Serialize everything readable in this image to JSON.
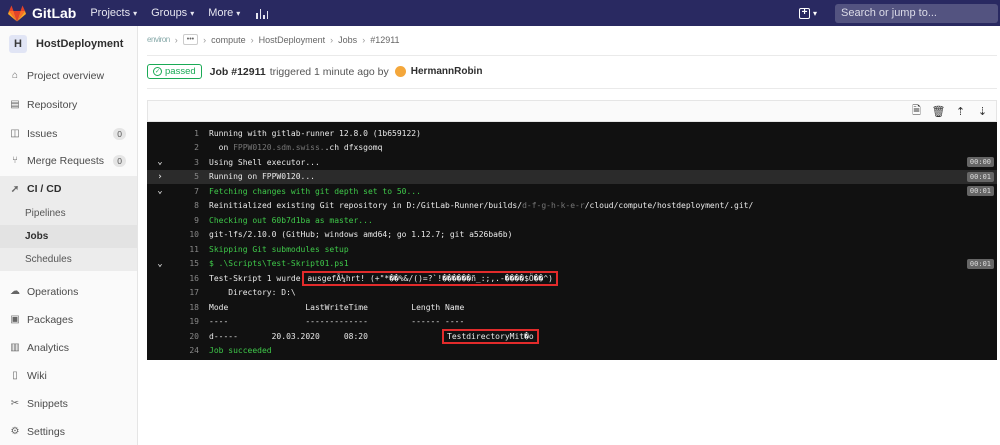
{
  "navbar": {
    "brand": "GitLab",
    "menu": [
      "Projects",
      "Groups",
      "More"
    ],
    "search_placeholder": "Search or jump to..."
  },
  "sidebar": {
    "project_initial": "H",
    "project_name": "HostDeployment",
    "items": [
      {
        "label": "Project overview",
        "icon": "home-icon"
      },
      {
        "label": "Repository",
        "icon": "doc-icon"
      },
      {
        "label": "Issues",
        "icon": "issues-icon",
        "badge": "0"
      },
      {
        "label": "Merge Requests",
        "icon": "merge-icon",
        "badge": "0"
      },
      {
        "label": "CI / CD",
        "icon": "rocket-icon"
      },
      {
        "label": "Operations",
        "icon": "cloud-icon"
      },
      {
        "label": "Packages",
        "icon": "package-icon"
      },
      {
        "label": "Analytics",
        "icon": "chart-icon"
      },
      {
        "label": "Wiki",
        "icon": "book-icon"
      },
      {
        "label": "Snippets",
        "icon": "scissors-icon"
      },
      {
        "label": "Settings",
        "icon": "gear-icon"
      }
    ],
    "cicd_sub": [
      "Pipelines",
      "Jobs",
      "Schedules"
    ]
  },
  "breadcrumbs": {
    "first": "environ",
    "items": [
      "compute",
      "HostDeployment",
      "Jobs",
      "#12911"
    ]
  },
  "job": {
    "status": "passed",
    "id": "Job #12911",
    "meta": "triggered 1 minute ago by",
    "user": "HermannRobin"
  },
  "log": {
    "lines": [
      {
        "n": "1",
        "text": "Running with gitlab-runner 12.8.0 (1b659122)"
      },
      {
        "n": "2",
        "text": "  on ",
        "blur": "FPPW0120.sdm.swiss.",
        "text2": ".ch dfxsgomq"
      },
      {
        "n": "3",
        "text": "Using Shell executor...",
        "tog": "v",
        "dur": "00:00"
      },
      {
        "n": "5",
        "text": "Running on FPPW0120...",
        "tog": ">",
        "dur": "00:01",
        "section": true
      },
      {
        "n": "7",
        "text": "Fetching changes with git depth set to 50...",
        "tog": "v",
        "dur": "00:01",
        "green": true
      },
      {
        "n": "8",
        "text": "Reinitialized existing Git repository in D:/GitLab-Runner/builds/",
        "blur": "d-f-g-h-k-e-r",
        "text2": "/cloud/compute/hostdeployment/.git/"
      },
      {
        "n": "9",
        "text": "Checking out 60b7d1ba as master...",
        "green": true
      },
      {
        "n": "10",
        "text": "git-lfs/2.10.0 (GitHub; windows amd64; go 1.12.7; git a526ba6b)"
      },
      {
        "n": "11",
        "text": "Skipping Git submodules setup",
        "green": true
      },
      {
        "n": "15",
        "text": "$ .\\Scripts\\Test-Skript01.ps1",
        "tog": "v",
        "dur": "00:01",
        "green": true
      },
      {
        "n": "16",
        "text": "Test-Skript 1 wurde ",
        "hl": "ausgefÃ¼hrt! (+\"*��%&/()=?`!������ñ_:;,.-����$Ö��^)"
      },
      {
        "n": "17",
        "text": "    Directory: D:\\"
      },
      {
        "n": "18",
        "text": "Mode                LastWriteTime         Length Name"
      },
      {
        "n": "19",
        "text": "----                -------------         ------ ----"
      },
      {
        "n": "20",
        "text": "d-----       20.03.2020     08:20                ",
        "hl": "TestdirectoryMit�o"
      },
      {
        "n": "24",
        "text": "Job succeeded",
        "green": true
      }
    ]
  },
  "colors": {
    "navbar": "#292961",
    "log_bg": "#111111",
    "success": "#1aaa55",
    "highlight": "#e22b2b"
  }
}
